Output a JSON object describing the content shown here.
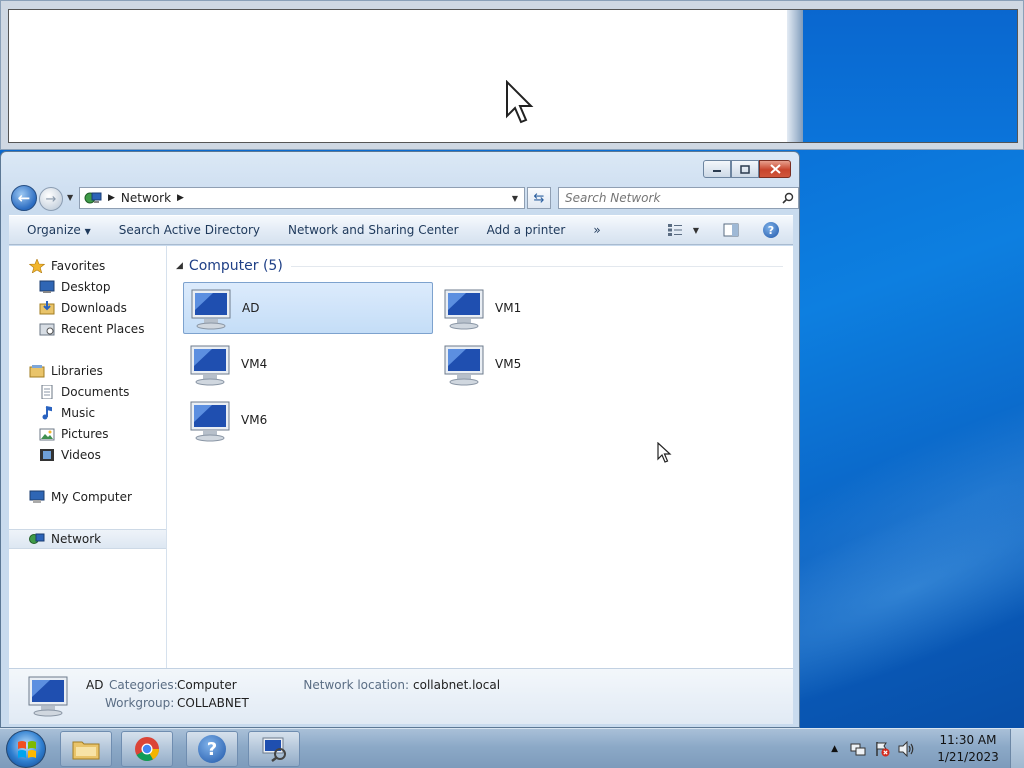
{
  "window": {
    "breadcrumb": "Network",
    "search_placeholder": "Search Network"
  },
  "toolbar": {
    "organize": "Organize",
    "items": [
      "Search Active Directory",
      "Network and Sharing Center",
      "Add a printer"
    ],
    "overflow": "»"
  },
  "nav": {
    "favorites": "Favorites",
    "desktop": "Desktop",
    "downloads": "Downloads",
    "recent_places": "Recent Places",
    "libraries": "Libraries",
    "documents": "Documents",
    "music": "Music",
    "pictures": "Pictures",
    "videos": "Videos",
    "my_computer": "My Computer",
    "network": "Network"
  },
  "content": {
    "group_header": "Computer (5)",
    "items": [
      "AD",
      "VM1",
      "VM4",
      "VM5",
      "VM6"
    ]
  },
  "details": {
    "name": "AD",
    "categories_label": "Categories:",
    "categories_value": "Computer",
    "workgroup_label": "Workgroup:",
    "workgroup_value": "COLLABNET",
    "network_location_label": "Network location:",
    "network_location_value": "collabnet.local"
  },
  "taskbar": {
    "time": "11:30 AM",
    "date": "1/21/2023"
  }
}
